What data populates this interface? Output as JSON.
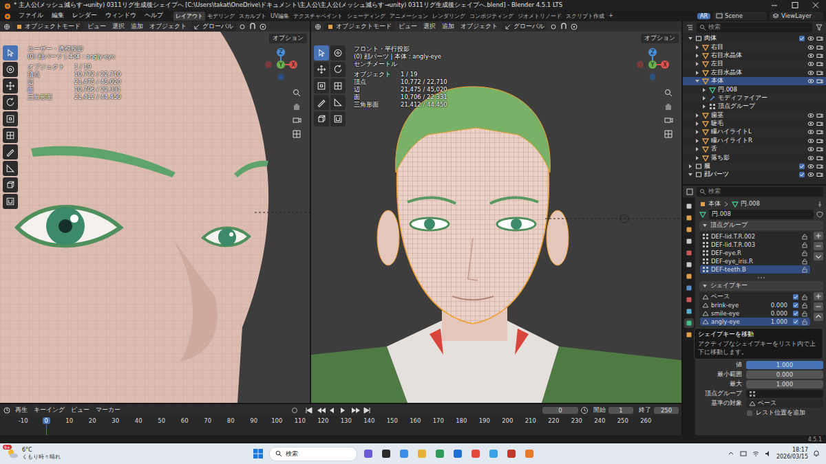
{
  "window": {
    "title": "* 主人公(メッシュ減らす→unity) 0311リグ生成後シェイプへ [C:\\Users\\takat\\OneDrive\\ドキュメント\\主人公\\主人公(メッシュ減らす→unity) 0311リグ生成後シェイプへ.blend] - Blender 4.5.1 LTS"
  },
  "menu": [
    "ファイル",
    "編集",
    "レンダー",
    "ウィンドウ",
    "ヘルプ"
  ],
  "workspaces": [
    {
      "label": "レイアウト",
      "selected": true
    },
    {
      "label": "モデリング",
      "selected": false
    },
    {
      "label": "スカルプト",
      "selected": false
    },
    {
      "label": "UV編集",
      "selected": false
    },
    {
      "label": "テクスチャペイント",
      "selected": false
    },
    {
      "label": "シェーディング",
      "selected": false
    },
    {
      "label": "アニメーション",
      "selected": false
    },
    {
      "label": "レンダリング",
      "selected": false
    },
    {
      "label": "コンポジティング",
      "selected": false
    },
    {
      "label": "ジオメトリノード",
      "selected": false
    },
    {
      "label": "スクリプト作成",
      "selected": false
    }
  ],
  "workspace_add": "+",
  "header_right": {
    "ar": "AR",
    "scene": "Scene",
    "view_layer": "ViewLayer"
  },
  "viewports": [
    {
      "kind": "closeup",
      "mode": "オブジェクトモード",
      "menus": [
        "ビュー",
        "選択",
        "追加",
        "オブジェクト"
      ],
      "orientation": "グローバル",
      "options": "オプション",
      "overlay": [
        "ユーザー・透視投影",
        "(0) 顔パーツ | 本体 : angly-eye"
      ],
      "stats": [
        {
          "label": "オブジェクト",
          "value": "1 / 19"
        },
        {
          "label": "頂点",
          "value": "10,772 / 22,710"
        },
        {
          "label": "辺",
          "value": "21,475 / 45,020"
        },
        {
          "label": "面",
          "value": "10,706 / 22,331"
        },
        {
          "label": "三角形面",
          "value": "21,412 / 44,450"
        }
      ],
      "gizmo": [
        "X",
        "Y",
        "Z"
      ],
      "tools": [
        {
          "selected": true
        },
        {
          "selected": false
        },
        {
          "selected": false
        },
        {
          "selected": false
        },
        {
          "selected": false
        },
        {
          "selected": false
        },
        {
          "selected": false
        },
        {
          "selected": false
        },
        {
          "selected": false
        },
        {
          "selected": false
        }
      ]
    },
    {
      "kind": "front",
      "mode": "オブジェクトモード",
      "menus": [
        "ビュー",
        "選択",
        "追加",
        "オブジェクト"
      ],
      "orientation": "グローバル",
      "options": "オプション",
      "overlay": [
        "フロント・平行投影",
        "(0) 顔パーツ | 本体 : angly-eye",
        "センチメートル"
      ],
      "stats": [
        {
          "label": "オブジェクト",
          "value": "1 / 19"
        },
        {
          "label": "頂点",
          "value": "10,772 / 22,710"
        },
        {
          "label": "辺",
          "value": "21,475 / 45,020"
        },
        {
          "label": "面",
          "value": "10,706 / 22,331"
        },
        {
          "label": "三角形面",
          "value": "21,412 / 44,450"
        }
      ],
      "gizmo": [
        "X",
        "Y",
        "Z"
      ],
      "tools": [
        {
          "selected": true
        },
        {
          "selected": false
        },
        {
          "selected": false
        },
        {
          "selected": false
        },
        {
          "selected": false
        },
        {
          "selected": false
        },
        {
          "selected": false
        },
        {
          "selected": false
        },
        {
          "selected": false
        },
        {
          "selected": false
        }
      ]
    }
  ],
  "outliner": {
    "search": "検索",
    "rows": [
      {
        "name": "肉体",
        "kind": "collection",
        "depth": 0,
        "expanded": true,
        "selected": false
      },
      {
        "name": "右目",
        "kind": "object",
        "depth": 1,
        "expanded": false,
        "selected": false
      },
      {
        "name": "右目水晶体",
        "kind": "object",
        "depth": 1,
        "expanded": false,
        "selected": false
      },
      {
        "name": "左目",
        "kind": "object",
        "depth": 1,
        "expanded": false,
        "selected": false
      },
      {
        "name": "左目水晶体",
        "kind": "object",
        "depth": 1,
        "expanded": false,
        "selected": false
      },
      {
        "name": "本体",
        "kind": "object",
        "depth": 1,
        "expanded": true,
        "selected": true
      },
      {
        "name": "円.008",
        "kind": "mesh",
        "depth": 2,
        "expanded": false,
        "selected": false
      },
      {
        "name": "モディファイアー",
        "kind": "modifier",
        "depth": 2,
        "expanded": false,
        "selected": false
      },
      {
        "name": "頂点グループ",
        "kind": "vgroup",
        "depth": 2,
        "expanded": false,
        "selected": false
      },
      {
        "name": "歯茎",
        "kind": "object",
        "depth": 1,
        "expanded": false,
        "selected": false
      },
      {
        "name": "睫毛",
        "kind": "object",
        "depth": 1,
        "expanded": false,
        "selected": false
      },
      {
        "name": "瞳ハイライトL",
        "kind": "object",
        "depth": 1,
        "expanded": false,
        "selected": false
      },
      {
        "name": "瞳ハイライトR",
        "kind": "object",
        "depth": 1,
        "expanded": false,
        "selected": false
      },
      {
        "name": "舌",
        "kind": "object",
        "depth": 1,
        "expanded": false,
        "selected": false
      },
      {
        "name": "落ち影",
        "kind": "object",
        "depth": 1,
        "expanded": false,
        "selected": false
      },
      {
        "name": "服",
        "kind": "collection",
        "depth": 0,
        "expanded": false,
        "selected": false
      },
      {
        "name": "顔パーツ",
        "kind": "collection",
        "depth": 0,
        "expanded": true,
        "selected": false
      }
    ]
  },
  "properties": {
    "search": "検索",
    "breadcrumb": [
      "本体",
      "円.008"
    ],
    "data_name": "円.008",
    "vertex_groups": {
      "title": "頂点グループ",
      "items": [
        {
          "name": "DEF-lid.T.R.002",
          "selected": false
        },
        {
          "name": "DEF-lid.T.R.003",
          "selected": false
        },
        {
          "name": "DEF-eye.R",
          "selected": false
        },
        {
          "name": "DEF-eye_iris.R",
          "selected": false
        },
        {
          "name": "DEF-teeth.B",
          "selected": true
        }
      ]
    },
    "shape_keys": {
      "title": "シェイプキー",
      "items": [
        {
          "name": "ベース",
          "value": "",
          "checked": true,
          "selected": false
        },
        {
          "name": "brink-eye",
          "value": "0.000",
          "checked": true,
          "selected": false
        },
        {
          "name": "smile-eye",
          "value": "0.000",
          "checked": true,
          "selected": false
        },
        {
          "name": "angly-eye",
          "value": "1.000",
          "checked": true,
          "selected": true
        }
      ]
    },
    "tooltip": {
      "title": "シェイプキーを移動",
      "body": "アクティブなシェイプキーをリスト内で上下に移動します。"
    },
    "fields": [
      {
        "label": "値",
        "value": "1.000",
        "kind": "slider",
        "level": 1
      },
      {
        "label": "最小範囲",
        "value": "0.000",
        "kind": "number",
        "level": 0
      },
      {
        "label": "最大",
        "value": "1.000",
        "kind": "number",
        "level": 0
      },
      {
        "label": "頂点グループ",
        "value": "",
        "kind": "search",
        "level": 0
      },
      {
        "label": "基準の対象",
        "value": "ベース",
        "kind": "select",
        "level": 0
      }
    ],
    "rest": {
      "label": "レスト位置を追加",
      "checked": false
    }
  },
  "timeline": {
    "menus": [
      "再生",
      "キーイング",
      "ビュー",
      "マーカー"
    ],
    "frame": "0",
    "start_label": "開始",
    "start": "1",
    "end_label": "終了",
    "end": "250",
    "ticks": [
      {
        "label": "-10",
        "selected": false
      },
      {
        "label": "0",
        "selected": true
      },
      {
        "label": "10",
        "selected": false
      },
      {
        "label": "20",
        "selected": false
      },
      {
        "label": "30",
        "selected": false
      },
      {
        "label": "40",
        "selected": false
      },
      {
        "label": "50",
        "selected": false
      },
      {
        "label": "60",
        "selected": false
      },
      {
        "label": "70",
        "selected": false
      },
      {
        "label": "80",
        "selected": false
      },
      {
        "label": "90",
        "selected": false
      },
      {
        "label": "100",
        "selected": false
      },
      {
        "label": "110",
        "selected": false
      },
      {
        "label": "120",
        "selected": false
      },
      {
        "label": "130",
        "selected": false
      },
      {
        "label": "140",
        "selected": false
      },
      {
        "label": "150",
        "selected": false
      },
      {
        "label": "160",
        "selected": false
      },
      {
        "label": "170",
        "selected": false
      },
      {
        "label": "180",
        "selected": false
      },
      {
        "label": "190",
        "selected": false
      },
      {
        "label": "200",
        "selected": false
      },
      {
        "label": "210",
        "selected": false
      },
      {
        "label": "220",
        "selected": false
      },
      {
        "label": "230",
        "selected": false
      },
      {
        "label": "240",
        "selected": false
      },
      {
        "label": "250",
        "selected": false
      },
      {
        "label": "260",
        "selected": false
      }
    ]
  },
  "status_bar": {
    "version": "4.5.1"
  },
  "taskbar": {
    "weather_badge": "9+",
    "temperature": "6°C",
    "weather": "くもり時々晴れ",
    "search": "検索",
    "time": "18:17",
    "date": "2026/03/15"
  }
}
